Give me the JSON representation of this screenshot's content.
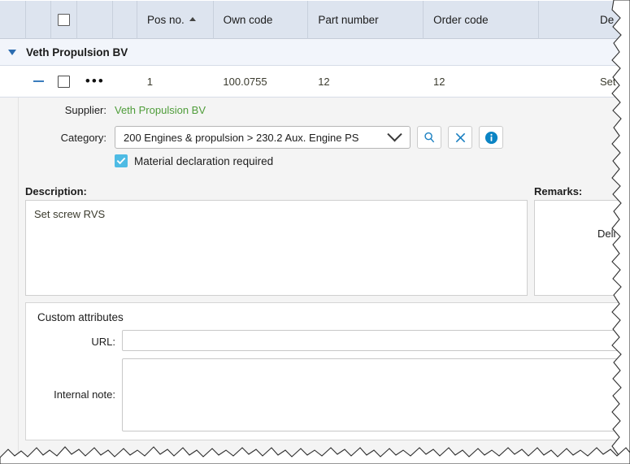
{
  "grid": {
    "columns": [
      {
        "id": "spacer1",
        "label": ""
      },
      {
        "id": "spacer2",
        "label": ""
      },
      {
        "id": "select-all",
        "label": ""
      },
      {
        "id": "spacer3",
        "label": ""
      },
      {
        "id": "spacer4",
        "label": ""
      },
      {
        "id": "pos-no",
        "label": "Pos no.",
        "sort": "asc"
      },
      {
        "id": "own-code",
        "label": "Own code"
      },
      {
        "id": "part-number",
        "label": "Part number"
      },
      {
        "id": "order-code",
        "label": "Order code"
      },
      {
        "id": "description",
        "label": "De"
      }
    ],
    "group_row": {
      "expanded": true,
      "label": "Veth Propulsion BV"
    },
    "row": {
      "expand_glyph": "minus",
      "menu_glyph": "•••",
      "pos_no": "1",
      "own_code": "100.0755",
      "part_number": "12",
      "order_code": "12",
      "description": "Set"
    },
    "cut_off": {
      "header_description": "De",
      "row_description": "Set",
      "detail_delivery": "Deli"
    }
  },
  "detail": {
    "supplier": {
      "label": "Supplier:",
      "value": "Veth Propulsion BV",
      "value_color": "#4f9d3a"
    },
    "category": {
      "label": "Category:",
      "value": "200 Engines & propulsion > 230.2 Aux. Engine PS",
      "buttons": [
        {
          "name": "search-icon",
          "title": ""
        },
        {
          "name": "clear-icon",
          "title": ""
        },
        {
          "name": "info-icon",
          "title": ""
        }
      ]
    },
    "material_declaration": {
      "label": "Material declaration required",
      "checked": true,
      "check_color": "#4ebbe4"
    },
    "description": {
      "label": "Description:",
      "value": "Set screw  RVS"
    },
    "remarks": {
      "label": "Remarks:",
      "value": ""
    },
    "custom_attributes": {
      "title": "Custom attributes",
      "url": {
        "label": "URL:",
        "value": ""
      },
      "internal_note": {
        "label": "Internal note:",
        "value": ""
      }
    }
  },
  "colors": {
    "header_bg": "#dde4ef",
    "group_bg": "#f2f5fb",
    "panel_bg": "#f4f4f4",
    "accent_blue": "#0b84c4",
    "caret_blue": "#2b6cb0"
  }
}
